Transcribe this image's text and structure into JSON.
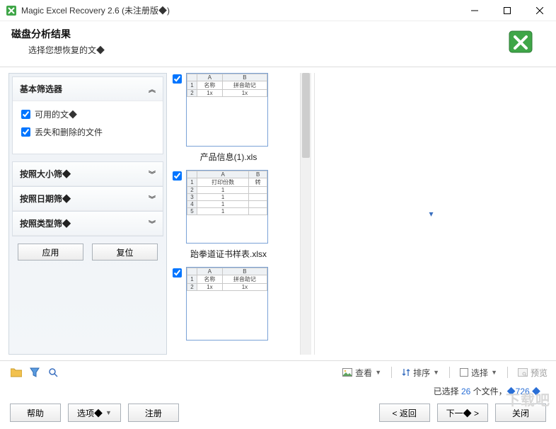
{
  "window": {
    "title": "Magic Excel Recovery 2.6 (未注册版◆)"
  },
  "header": {
    "title": "磁盘分析结果",
    "subtitle": "选择您想恢复的文◆"
  },
  "filters": {
    "basic": {
      "label": "基本筛选器",
      "expanded": true
    },
    "available_files": "可用的文◆",
    "lost_deleted": "丢失和删除的文件",
    "by_size": "按照大小筛◆",
    "by_date": "按照日期筛◆",
    "by_type": "按照类型筛◆",
    "apply": "应用",
    "reset": "复位"
  },
  "files": [
    {
      "name": "产品信息(1).xls",
      "checked": true,
      "cols": [
        "A",
        "B"
      ],
      "rows": [
        [
          "名称",
          "拼音助记"
        ],
        [
          "1x",
          "1x"
        ]
      ]
    },
    {
      "name": "跆拳道证书样表.xlsx",
      "checked": true,
      "cols": [
        "A",
        "B"
      ],
      "rows": [
        [
          "打印份数",
          "转"
        ],
        [
          "1",
          ""
        ],
        [
          "1",
          ""
        ],
        [
          "1",
          ""
        ],
        [
          "1",
          ""
        ]
      ]
    },
    {
      "name": "",
      "checked": true,
      "cols": [
        "A",
        "B"
      ],
      "rows": [
        [
          "名称",
          "拼音助记"
        ],
        [
          "1x",
          "1x"
        ]
      ]
    }
  ],
  "toolbar": {
    "view": "查看",
    "sort": "排序",
    "select": "选择",
    "preview": "预览"
  },
  "status": {
    "prefix": "已选择 ",
    "count": "26",
    "mid": " 个文件，",
    "size": "◆726 ◆"
  },
  "footer": {
    "help": "帮助",
    "options": "选项◆",
    "register": "注册",
    "back": "< 返回",
    "next": "下一◆ >",
    "close": "关闭"
  },
  "watermark": "下载吧"
}
